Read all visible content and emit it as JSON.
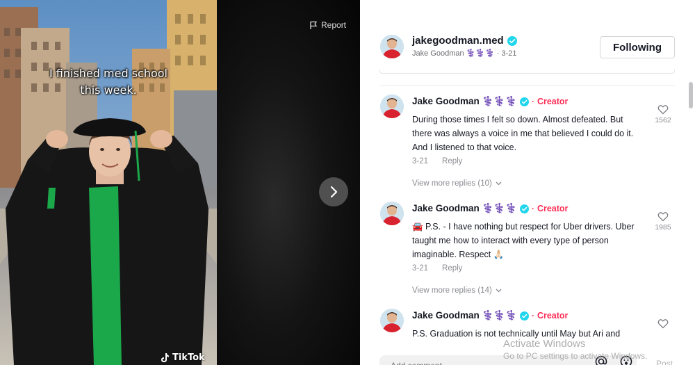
{
  "video": {
    "caption_line1": "I finished med school",
    "caption_line2": "this week.",
    "watermark": "TikTok",
    "report_label": "Report"
  },
  "author": {
    "username": "jakegoodman.med",
    "display_name": "Jake Goodman ⚕️⚕️⚕️",
    "date": "3-21",
    "follow_label": "Following",
    "sub_line": "Jake Goodman ⚕️⚕️⚕️ · 3-21"
  },
  "comments": [
    {
      "name": "Jake Goodman ⚕️⚕️⚕️",
      "badge": "Creator",
      "text": "During those times I felt so down. Almost defeated. But there was always a voice in me that believed I could do it. And I listened to that voice.",
      "date": "3-21",
      "reply_label": "Reply",
      "likes": "1562",
      "more_replies": "View more replies (10)"
    },
    {
      "name": "Jake Goodman ⚕️⚕️⚕️",
      "badge": "Creator",
      "text": "🚘 P.S. - I have nothing but respect for Uber drivers. Uber taught me how to interact with every type of person imaginable. Respect 🙏🏻",
      "date": "3-21",
      "reply_label": "Reply",
      "likes": "1985",
      "more_replies": "View more replies (14)"
    },
    {
      "name": "Jake Goodman ⚕️⚕️⚕️",
      "badge": "Creator",
      "text": "P.S. Graduation is not technically until May but Ari and",
      "likes": ""
    }
  ],
  "composer": {
    "placeholder": "Add comment...",
    "post_label": "Post"
  },
  "os_overlay": {
    "title": "Activate Windows",
    "subtitle": "Go to PC settings to activate Windows."
  },
  "colors": {
    "accent": "#fe2c55",
    "verified": "#20d5ec",
    "gown_green": "#1aa84a"
  }
}
